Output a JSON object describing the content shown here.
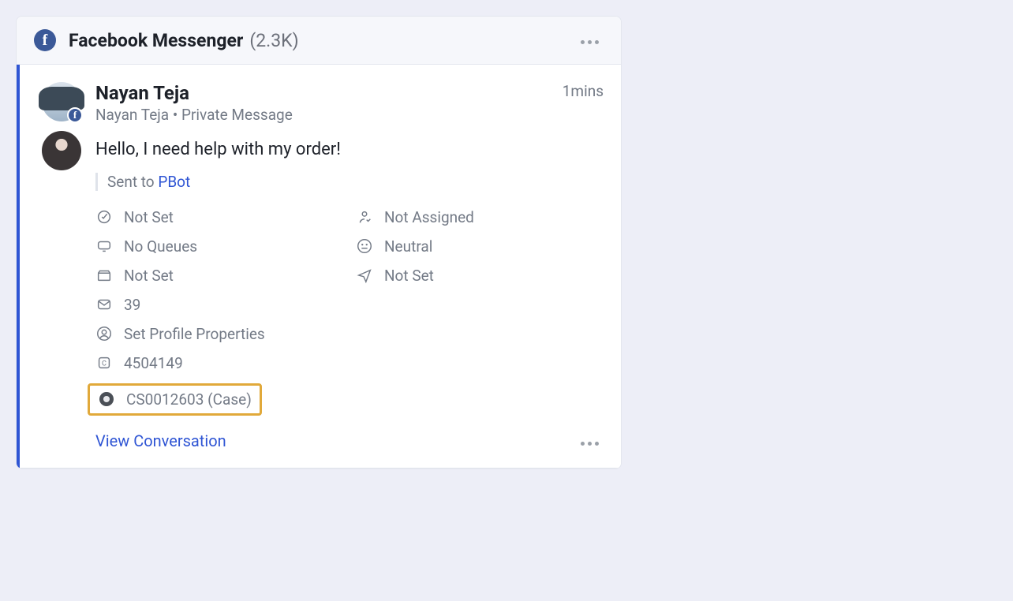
{
  "header": {
    "channel_name": "Facebook Messenger",
    "count_label": "(2.3K)"
  },
  "thread": {
    "sender_name": "Nayan Teja",
    "sender_sub": "Nayan Teja • Private Message",
    "time": "1mins",
    "message": "Hello, I need help with my order!",
    "sent_to_prefix": "Sent to ",
    "sent_to_target": "PBot",
    "meta": {
      "priority": "Not Set",
      "assignee": "Not Assigned",
      "queues": "No Queues",
      "sentiment": "Neutral",
      "product": "Not Set",
      "destination": "Not Set",
      "count": "39",
      "profile": "Set Profile Properties",
      "case_id": "4504149",
      "linked_case": "CS0012603 (Case)"
    },
    "view_link": "View Conversation"
  }
}
